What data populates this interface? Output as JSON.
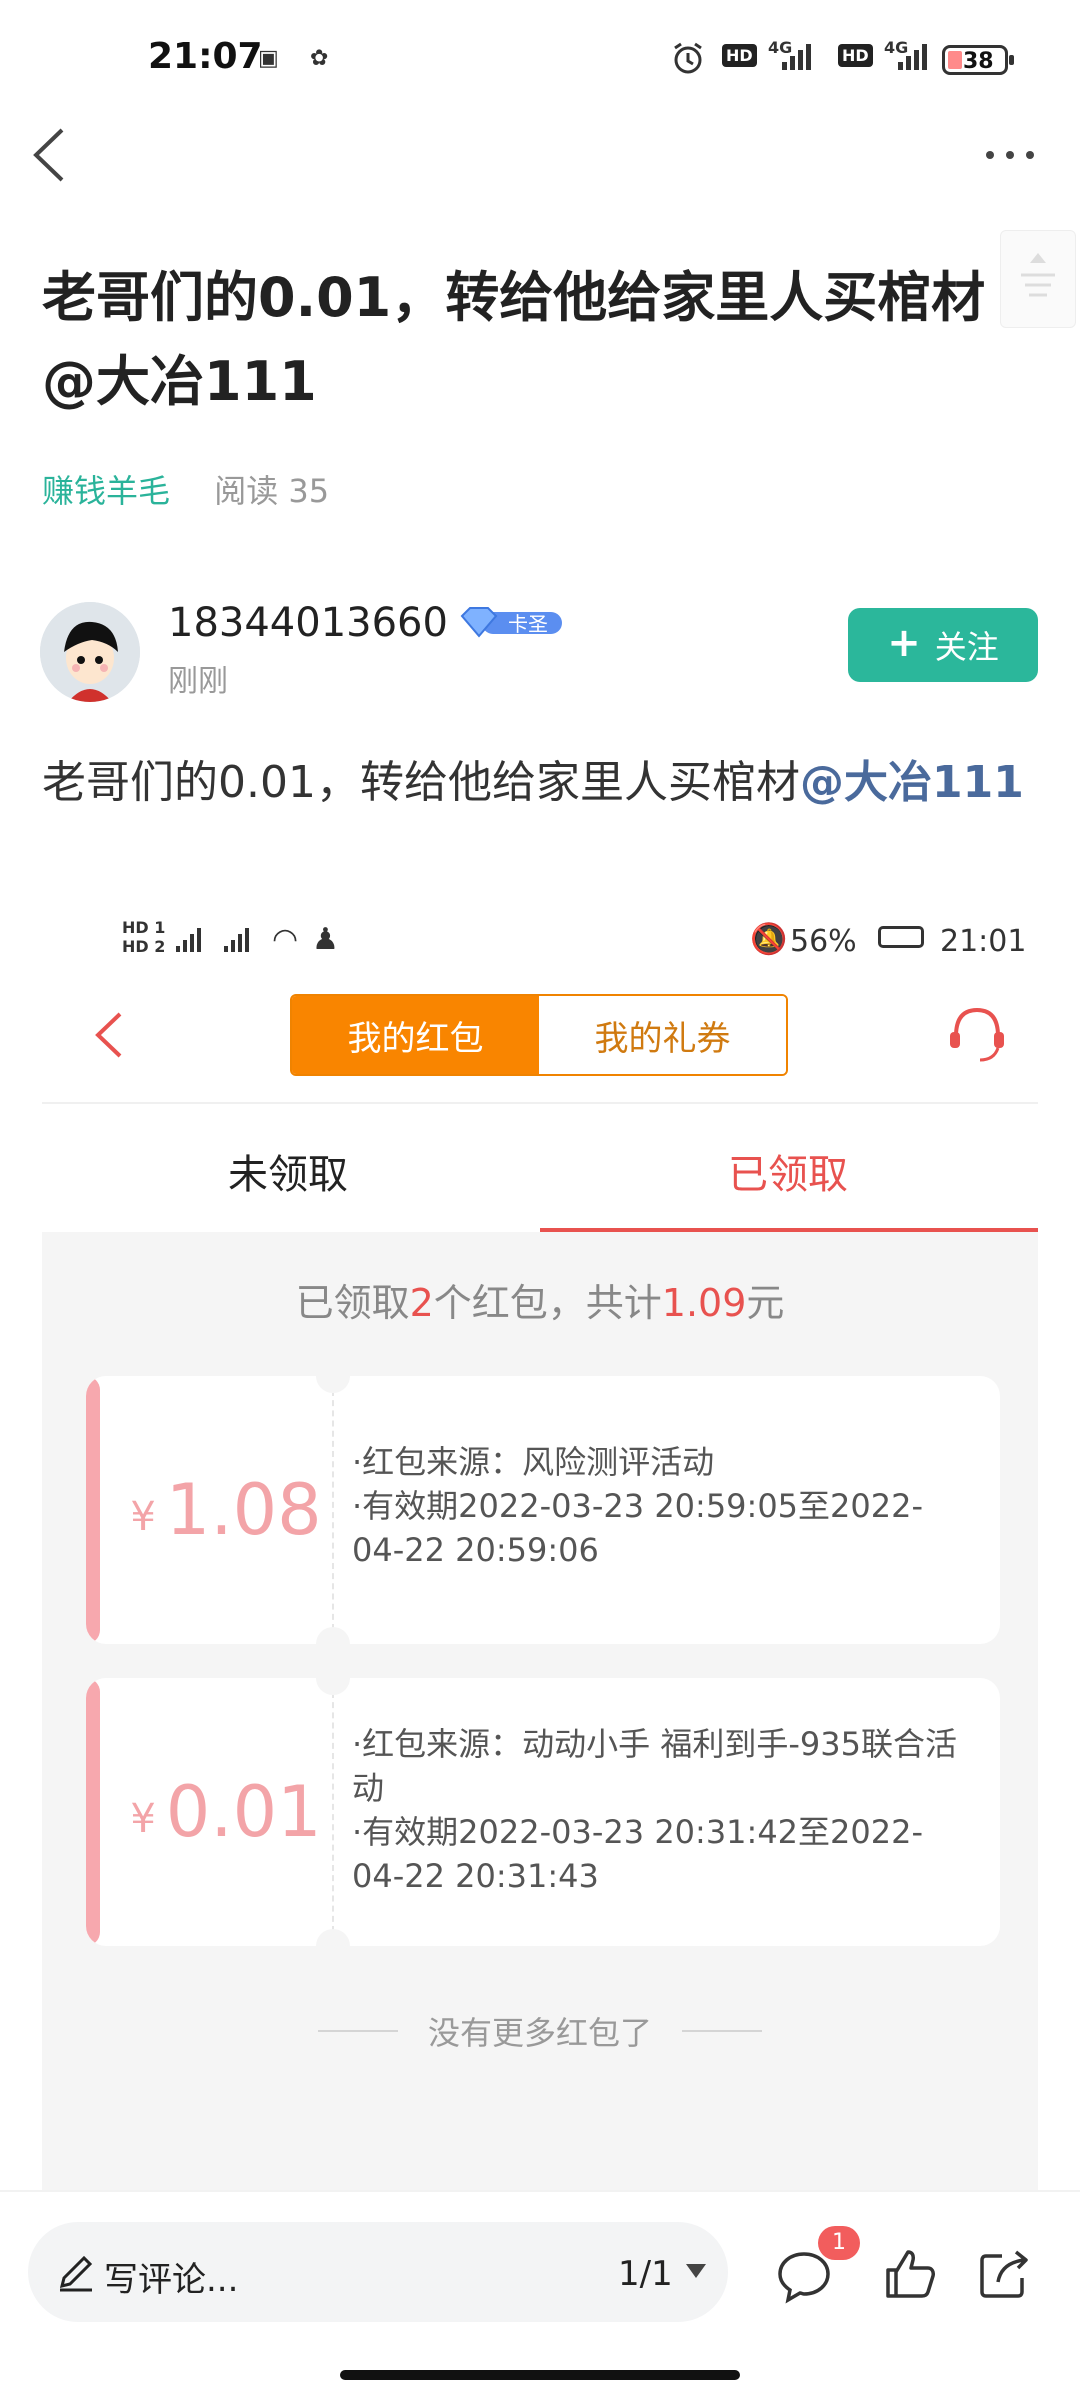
{
  "status_bar": {
    "time": "21:07",
    "battery": "38",
    "network": "4G",
    "hd": "HD"
  },
  "post": {
    "title": "老哥们的0.01，转给他给家里人买棺材@大冶111",
    "category": "赚钱羊毛",
    "read_count": "阅读 35",
    "author": "18344013660",
    "badge_label": "卡圣",
    "post_time": "刚刚",
    "follow_label": "关注",
    "body_text": "老哥们的0.01，转给他给家里人买棺材",
    "mention": "@大冶111"
  },
  "embedded": {
    "status": {
      "battery_pct": "56%",
      "time": "21:01"
    },
    "tab_active": "我的红包",
    "tab_other": "我的礼券",
    "subtab_unclaimed": "未领取",
    "subtab_claimed": "已领取",
    "summary": {
      "prefix": "已领取",
      "count": "2",
      "mid": "个红包，共计",
      "total": "1.09",
      "suffix": "元"
    },
    "currency": "¥",
    "cards": [
      {
        "amount": "1.08",
        "source": "·红包来源：风险测评活动",
        "validity": "·有效期2022-03-23 20:59:05至2022-04-22 20:59:06"
      },
      {
        "amount": "0.01",
        "source": "·红包来源：动动小手 福利到手-935联合活动",
        "validity": "·有效期2022-03-23 20:31:42至2022-04-22 20:31:43"
      }
    ],
    "no_more": "没有更多红包了"
  },
  "bottom": {
    "comment_placeholder": "写评论...",
    "page_indicator": "1/1",
    "comment_badge": "1"
  },
  "colors": {
    "accent_green": "#2bb79b",
    "orange": "#f98500",
    "red": "#e8524f",
    "pink": "#f3a4a8",
    "mention_blue": "#4a6a9c"
  },
  "icons": [
    "back-arrow-icon",
    "more-icon",
    "diamond-icon",
    "plus-icon",
    "customer-service-icon",
    "pencil-icon",
    "dropdown-icon",
    "comment-icon",
    "like-icon",
    "share-icon"
  ]
}
